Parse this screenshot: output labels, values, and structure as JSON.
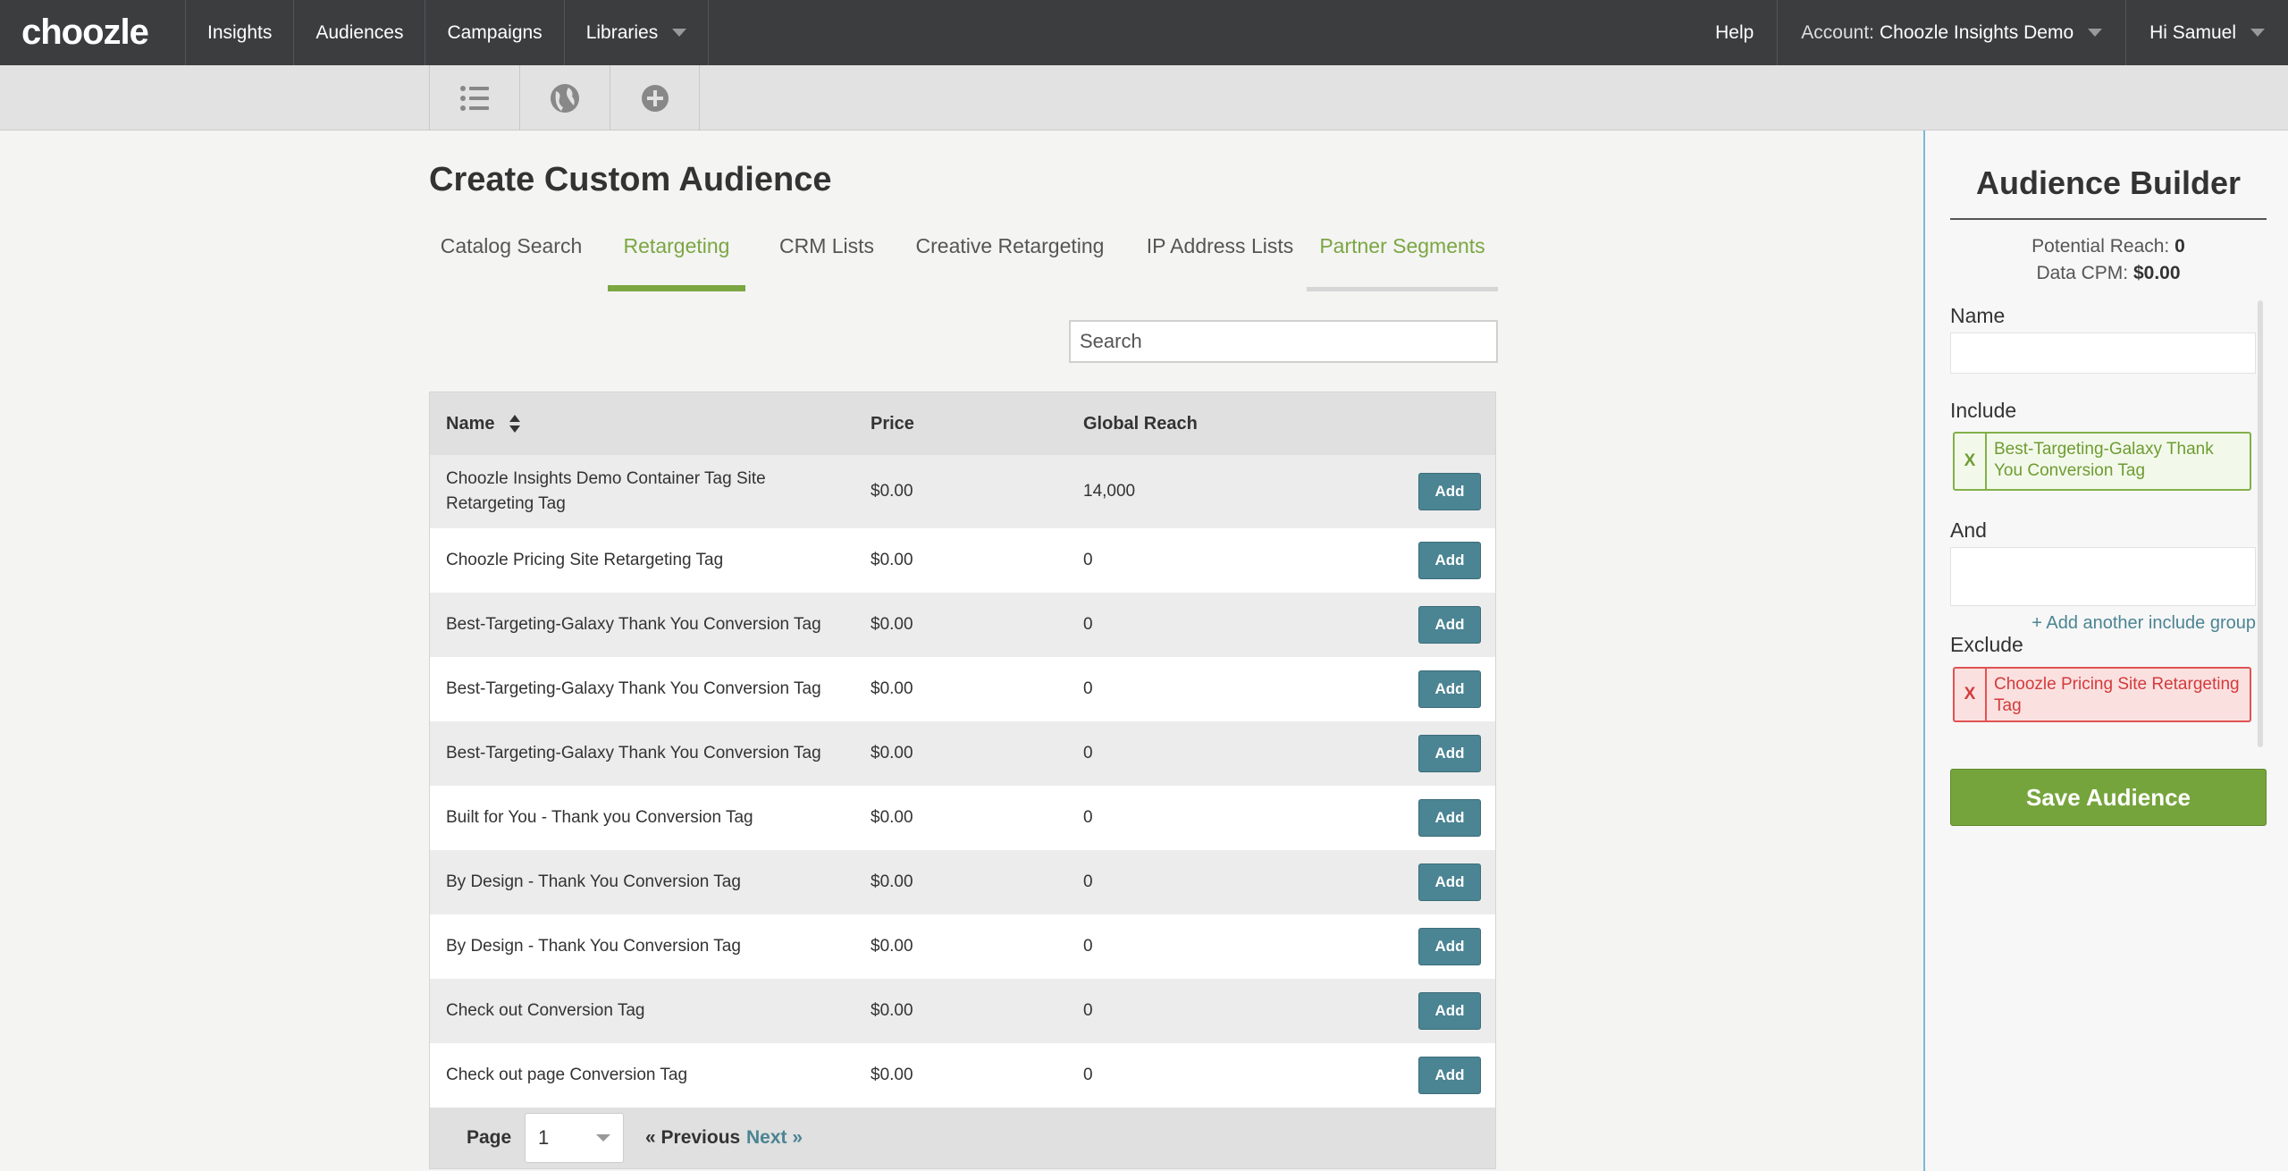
{
  "nav": {
    "logo": "choozle",
    "items": [
      "Insights",
      "Audiences",
      "Campaigns",
      "Libraries"
    ],
    "help": "Help",
    "account_label": "Account:",
    "account_name": "Choozle Insights Demo",
    "greeting": "Hi Samuel"
  },
  "toolbar": {
    "icons": [
      "list-icon",
      "globe-icon",
      "plus-circle-icon"
    ]
  },
  "page": {
    "title": "Create Custom Audience",
    "tabs": [
      "Catalog Search",
      "Retargeting",
      "CRM Lists",
      "Creative Retargeting",
      "IP Address Lists",
      "Partner Segments"
    ],
    "active_tab": "Retargeting",
    "search_placeholder": "Search"
  },
  "table": {
    "headers": {
      "name": "Name",
      "price": "Price",
      "reach": "Global Reach"
    },
    "add_label": "Add",
    "rows": [
      {
        "name": "Choozle Insights Demo Container Tag Site Retargeting Tag",
        "price": "$0.00",
        "reach": "14,000"
      },
      {
        "name": "Choozle Pricing Site Retargeting Tag",
        "price": "$0.00",
        "reach": "0"
      },
      {
        "name": "Best-Targeting-Galaxy Thank You Conversion Tag",
        "price": "$0.00",
        "reach": "0"
      },
      {
        "name": "Best-Targeting-Galaxy Thank You Conversion Tag",
        "price": "$0.00",
        "reach": "0"
      },
      {
        "name": "Best-Targeting-Galaxy Thank You Conversion Tag",
        "price": "$0.00",
        "reach": "0"
      },
      {
        "name": "Built for You - Thank you Conversion Tag",
        "price": "$0.00",
        "reach": "0"
      },
      {
        "name": "By Design - Thank You Conversion Tag",
        "price": "$0.00",
        "reach": "0"
      },
      {
        "name": "By Design - Thank You Conversion Tag",
        "price": "$0.00",
        "reach": "0"
      },
      {
        "name": "Check out Conversion Tag",
        "price": "$0.00",
        "reach": "0"
      },
      {
        "name": "Check out page Conversion Tag",
        "price": "$0.00",
        "reach": "0"
      }
    ]
  },
  "pager": {
    "label": "Page",
    "current": "1",
    "prev": "« Previous",
    "next": "Next »"
  },
  "builder": {
    "title": "Audience Builder",
    "potential_reach_label": "Potential Reach:",
    "potential_reach": "0",
    "data_cpm_label": "Data CPM:",
    "data_cpm": "$0.00",
    "name_label": "Name",
    "include_label": "Include",
    "include_item": "Best-Targeting-Galaxy Thank You Conversion Tag",
    "and_label": "And",
    "add_group": "+ Add another include group",
    "exclude_label": "Exclude",
    "exclude_item": "Choozle Pricing Site Retargeting Tag",
    "remove": "X",
    "save": "Save Audience"
  }
}
